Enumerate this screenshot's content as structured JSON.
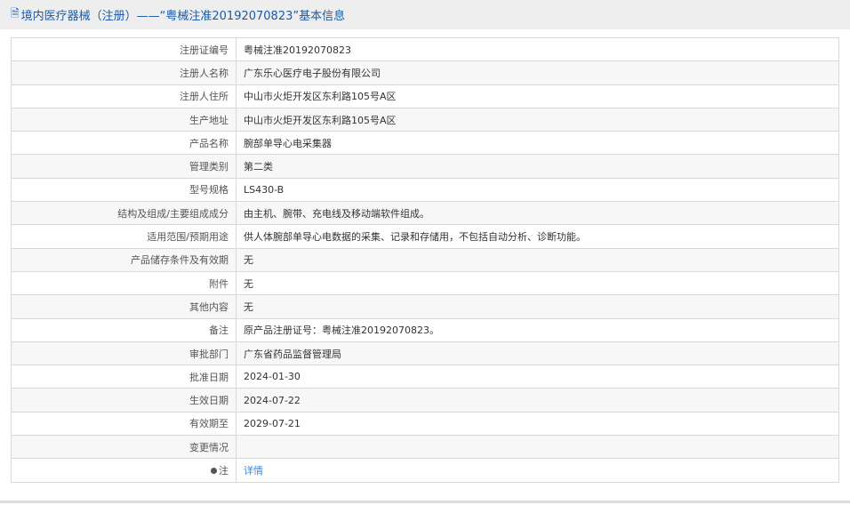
{
  "header": {
    "title": "境内医疗器械（注册）——“粤械注准20192070823”基本信息"
  },
  "rows": [
    {
      "label": "注册证编号",
      "value": "粤械注准20192070823"
    },
    {
      "label": "注册人名称",
      "value": "广东乐心医疗电子股份有限公司"
    },
    {
      "label": "注册人住所",
      "value": "中山市火炬开发区东利路105号A区"
    },
    {
      "label": "生产地址",
      "value": "中山市火炬开发区东利路105号A区"
    },
    {
      "label": "产品名称",
      "value": "腕部单导心电采集器"
    },
    {
      "label": "管理类别",
      "value": "第二类"
    },
    {
      "label": "型号规格",
      "value": "LS430-B"
    },
    {
      "label": "结构及组成/主要组成成分",
      "value": "由主机、腕带、充电线及移动端软件组成。"
    },
    {
      "label": "适用范围/预期用途",
      "value": "供人体腕部单导心电数据的采集、记录和存储用，不包括自动分析、诊断功能。"
    },
    {
      "label": "产品储存条件及有效期",
      "value": "无"
    },
    {
      "label": "附件",
      "value": "无"
    },
    {
      "label": "其他内容",
      "value": "无"
    },
    {
      "label": "备注",
      "value": "原产品注册证号：粤械注准20192070823。"
    },
    {
      "label": "审批部门",
      "value": "广东省药品监督管理局"
    },
    {
      "label": "批准日期",
      "value": "2024-01-30"
    },
    {
      "label": "生效日期",
      "value": "2024-07-22"
    },
    {
      "label": "有效期至",
      "value": "2029-07-21"
    },
    {
      "label": "变更情况",
      "value": ""
    }
  ],
  "note": {
    "label": "注",
    "link": "详情"
  }
}
